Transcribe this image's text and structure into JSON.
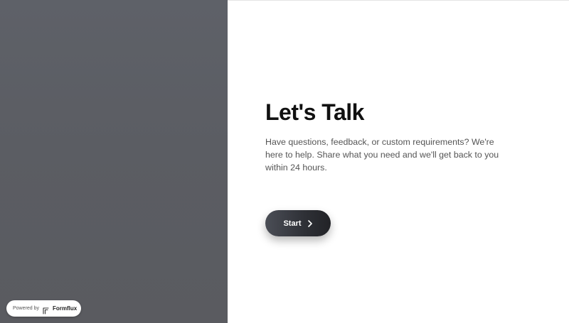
{
  "form": {
    "title": "Let's Talk",
    "description": "Have questions, feedback, or custom requirements? We're here to help. Share what you need and we'll get back to you within 24 hours.",
    "start_label": "Start",
    "start_icon": "chevron-right-icon"
  },
  "badge": {
    "powered_label": "Powered by",
    "brand": "Formflux",
    "logo_icon": "formflux-logo-icon"
  },
  "colors": {
    "left_panel": "#5b5d63",
    "button_dark": "#2e3036",
    "title_text": "#111111",
    "body_text": "#555555"
  }
}
